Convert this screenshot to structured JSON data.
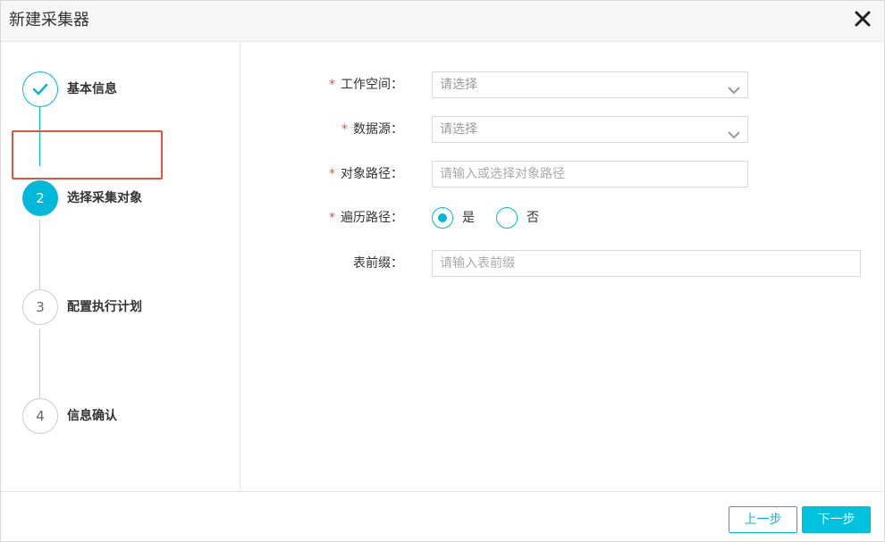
{
  "dialog": {
    "title": "新建采集器",
    "close_icon": "close-icon"
  },
  "steps": [
    {
      "number": "",
      "label": "基本信息",
      "state": "done",
      "icon": "check-icon"
    },
    {
      "number": "2",
      "label": "选择采集对象",
      "state": "active"
    },
    {
      "number": "3",
      "label": "配置执行计划",
      "state": "pending"
    },
    {
      "number": "4",
      "label": "信息确认",
      "state": "pending"
    }
  ],
  "form": {
    "workspace": {
      "required_mark": "*",
      "label": "工作空间：",
      "placeholder": "请选择"
    },
    "datasource": {
      "required_mark": "*",
      "label": "数据源：",
      "placeholder": "请选择"
    },
    "object_path": {
      "required_mark": "*",
      "label": "对象路径：",
      "placeholder": "请输入或选择对象路径"
    },
    "traverse_path": {
      "required_mark": "*",
      "label": "遍历路径：",
      "options": [
        {
          "label": "是",
          "checked": true
        },
        {
          "label": "否",
          "checked": false
        }
      ]
    },
    "table_prefix": {
      "label": "表前缀：",
      "placeholder": "请输入表前缀"
    }
  },
  "footer": {
    "prev_label": "上一步",
    "next_label": "下一步"
  },
  "colors": {
    "accent": "#00b9d8",
    "required": "#e2553a",
    "highlight_border": "#e2553a"
  }
}
